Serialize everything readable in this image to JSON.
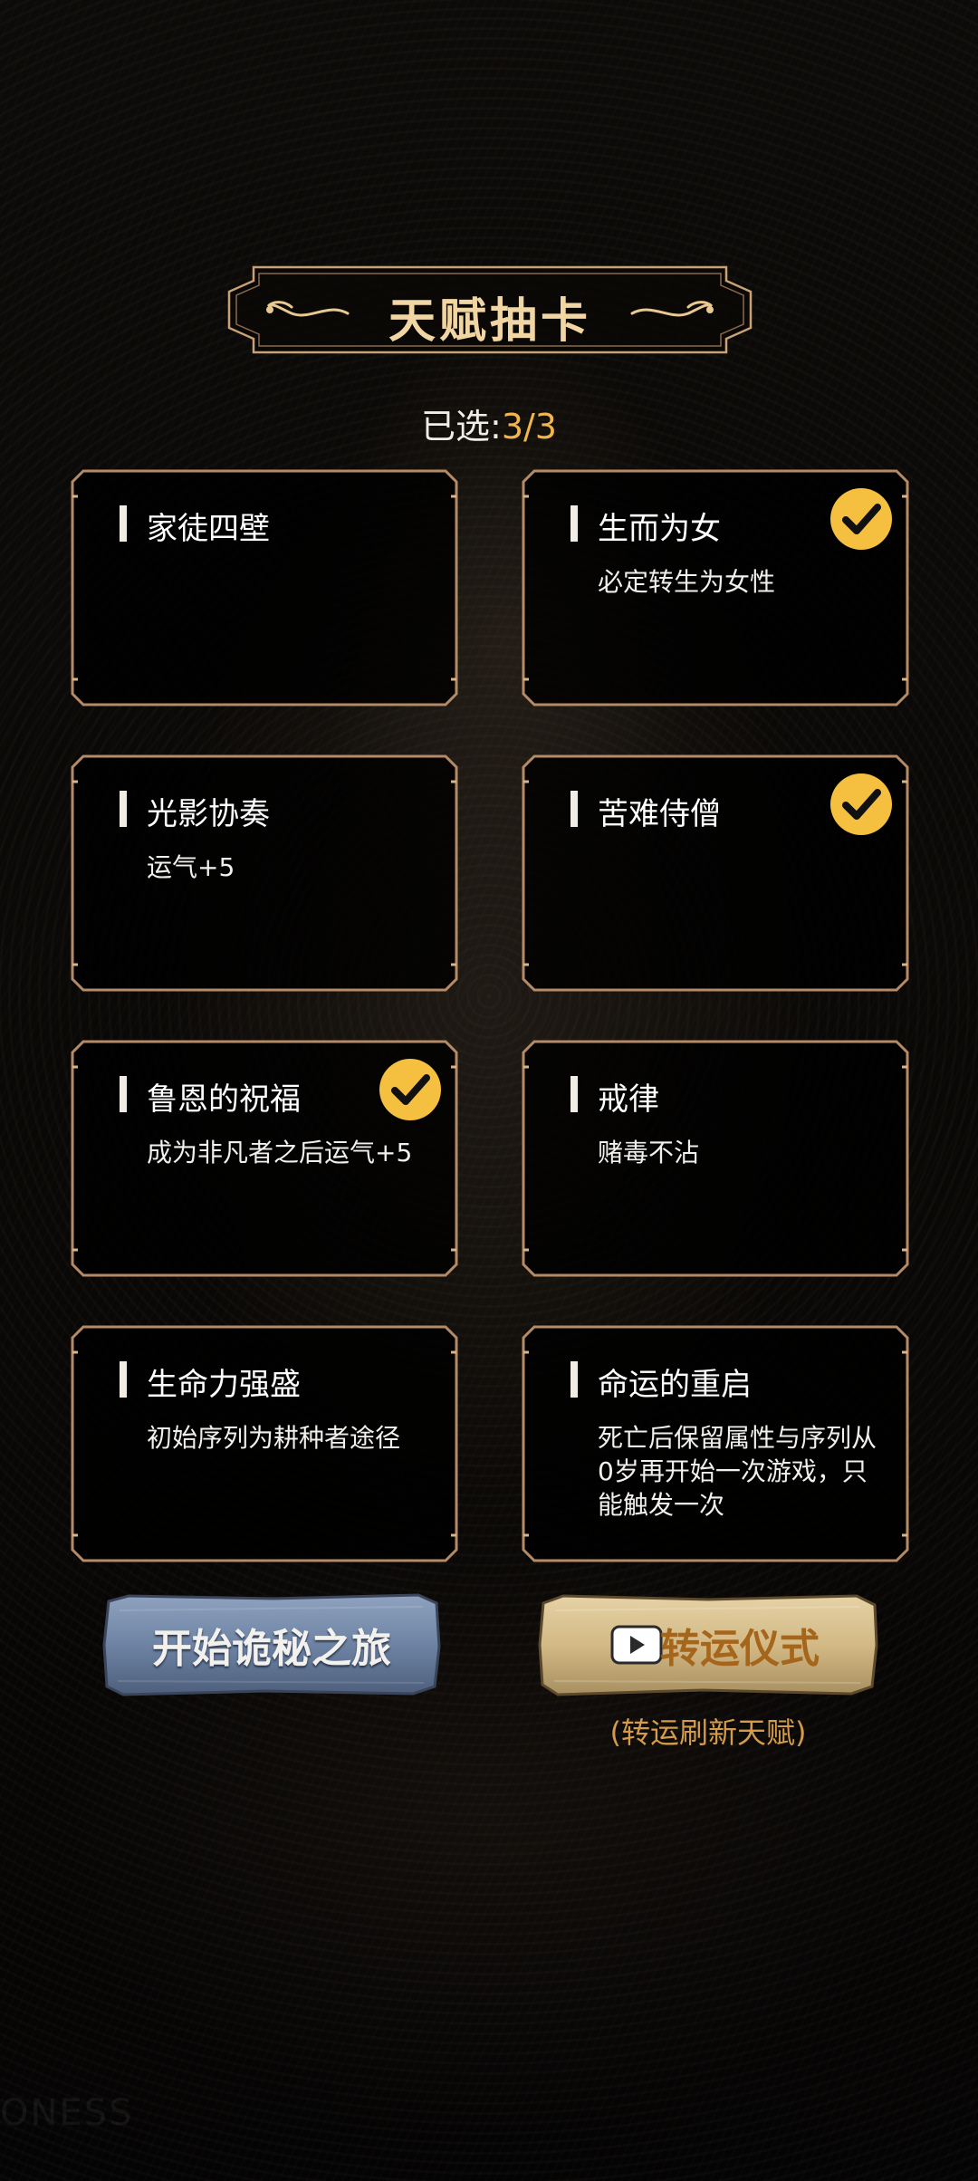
{
  "title": "天赋抽卡",
  "selection": {
    "label": "已选:",
    "count": "3/3"
  },
  "cards": [
    {
      "title": "家徒四壁",
      "desc": "",
      "selected": false
    },
    {
      "title": "生而为女",
      "desc": "必定转生为女性",
      "selected": true
    },
    {
      "title": "光影协奏",
      "desc": "运气+5",
      "selected": false
    },
    {
      "title": "苦难侍僧",
      "desc": "",
      "selected": true
    },
    {
      "title": "鲁恩的祝福",
      "desc": "成为非凡者之后运气+5",
      "selected": true
    },
    {
      "title": "戒律",
      "desc": "赌毒不沾",
      "selected": false
    },
    {
      "title": "生命力强盛",
      "desc": "初始序列为耕种者途径",
      "selected": false
    },
    {
      "title": "命运的重启",
      "desc": "死亡后保留属性与序列从0岁再开始一次游戏，只能触发一次",
      "selected": false
    }
  ],
  "buttons": {
    "start_label": "开始诡秘之旅",
    "fortune_label": "转运仪式",
    "fortune_hint": "(转运刷新天赋)"
  },
  "watermark": "ONESS",
  "colors": {
    "gold": "#f1d6a3",
    "accent": "#f2b54c",
    "frame": "#b58a66",
    "badge": "#f5c040"
  },
  "icons": {
    "check": "check-icon",
    "video": "video-camera-icon",
    "flourish": "scroll-flourish-icon"
  }
}
